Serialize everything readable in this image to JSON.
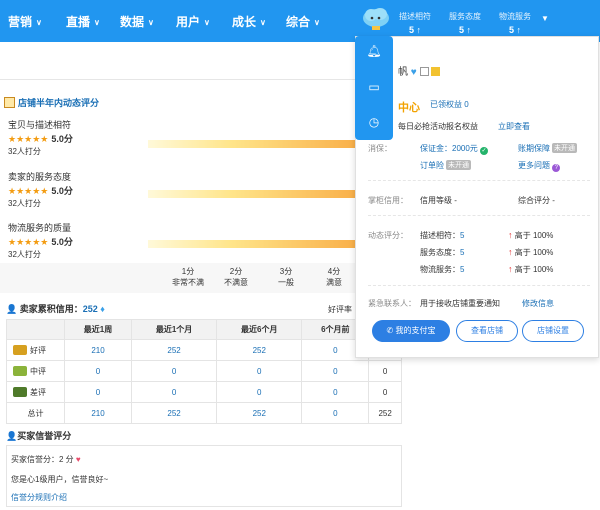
{
  "nav": {
    "items": [
      "营销",
      "直播",
      "数据",
      "用户",
      "成长",
      "综合"
    ],
    "metrics": [
      {
        "label": "描述相符",
        "value": "5 ↑"
      },
      {
        "label": "服务态度",
        "value": "5 ↑"
      },
      {
        "label": "物流服务",
        "value": "5 ↑"
      }
    ]
  },
  "rating": {
    "title": "店铺半年内动态评分",
    "items": [
      {
        "label": "宝贝与描述相符",
        "stars": "★★★★★",
        "score": "5.0分",
        "count": "32人打分"
      },
      {
        "label": "卖家的服务态度",
        "stars": "★★★★★",
        "score": "5.0分",
        "count": "32人打分"
      },
      {
        "label": "物流服务的质量",
        "stars": "★★★★★",
        "score": "5.0分",
        "count": "32人打分"
      }
    ],
    "scale": [
      {
        "n": "1分",
        "t": "非常不满"
      },
      {
        "n": "2分",
        "t": "不满意"
      },
      {
        "n": "3分",
        "t": "一般"
      },
      {
        "n": "4分",
        "t": "满意"
      }
    ]
  },
  "seller": {
    "label": "卖家累积信用：",
    "value": "252",
    "good_rate": "好评率"
  },
  "table": {
    "headers": [
      "",
      "最近1周",
      "最近1个月",
      "最近6个月",
      "6个月前",
      ""
    ],
    "rows": [
      {
        "label": "好评",
        "vals": [
          "210",
          "252",
          "252",
          "0",
          ""
        ]
      },
      {
        "label": "中评",
        "vals": [
          "0",
          "0",
          "0",
          "0",
          "0"
        ]
      },
      {
        "label": "差评",
        "vals": [
          "0",
          "0",
          "0",
          "0",
          "0"
        ]
      },
      {
        "label": "总计",
        "vals": [
          "210",
          "252",
          "252",
          "0",
          "252"
        ]
      }
    ]
  },
  "buyer": {
    "title": "买家信誉评分",
    "score_line": "买家信誉分：2 分",
    "desc": "您是心1级用户，信誉良好~",
    "link": "信誉分规则介绍"
  },
  "panel": {
    "shop_suffix": "帆",
    "center_suffix": "中心",
    "claimed": "已领权益 0",
    "daily": "每日必抢活动报名权益",
    "claim_now": "立即查看",
    "consumer_label": "消保：",
    "deposit": "保证金：2000元",
    "account_protect": "账期保障",
    "order_risk": "订单险",
    "not_open": "未开通",
    "more_issues": "更多问题",
    "credit_label": "掌柜信用：",
    "credit_level": "信用等级 -",
    "overall": "综合评分 -",
    "dynamic_label": "动态评分：",
    "dyn": [
      {
        "name": "描述相符：",
        "val": "5",
        "up": "高于 100%"
      },
      {
        "name": "服务态度：",
        "val": "5",
        "up": "高于 100%"
      },
      {
        "name": "物流服务：",
        "val": "5",
        "up": "高于 100%"
      }
    ],
    "contact_label": "紧急联系人：",
    "contact_text": "用于接收店铺重要通知",
    "modify": "修改信息",
    "btn_alipay": "我的支付宝",
    "btn_shop": "查看店铺",
    "btn_settings": "店铺设置"
  }
}
